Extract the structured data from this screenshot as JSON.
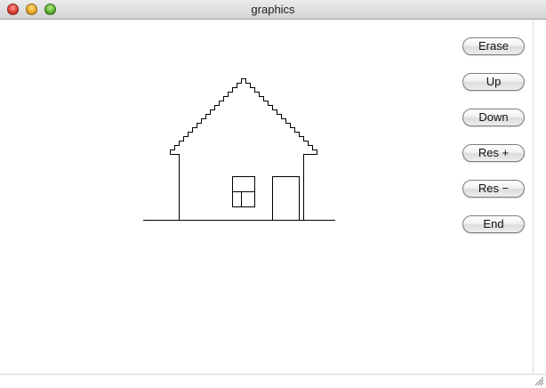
{
  "window": {
    "title": "graphics"
  },
  "buttons": {
    "erase": "Erase",
    "up": "Up",
    "down": "Down",
    "res_plus": "Res +",
    "res_minus": "Res −",
    "end": "End"
  }
}
